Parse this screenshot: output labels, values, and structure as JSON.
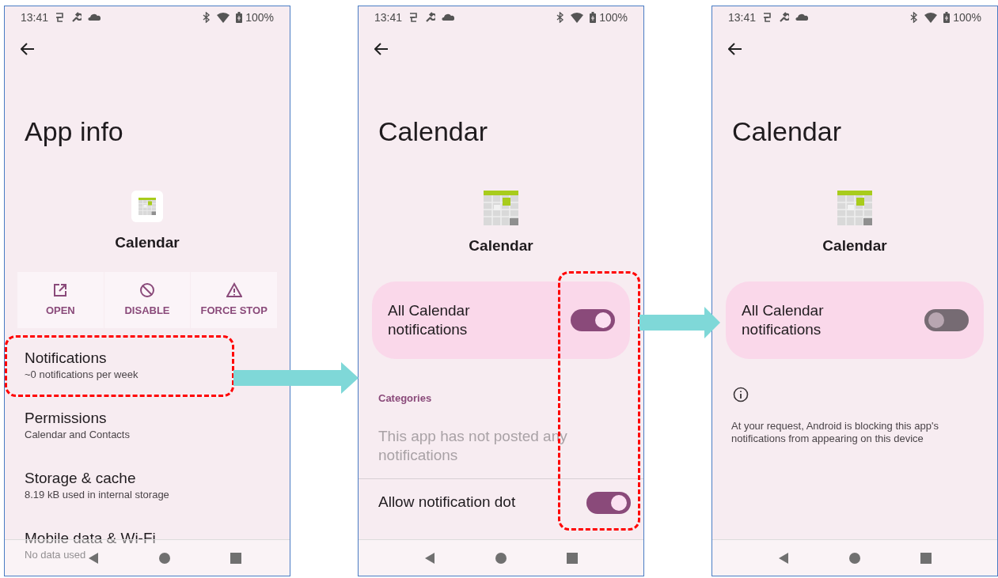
{
  "screens": [
    {
      "kind": "app_info",
      "status_bar": {
        "time": "13:41",
        "battery": "100%"
      },
      "title": "App info",
      "app_name": "Calendar",
      "actions": [
        {
          "kind": "open",
          "label": "OPEN"
        },
        {
          "kind": "disable",
          "label": "DISABLE"
        },
        {
          "kind": "stop",
          "label": "FORCE STOP"
        }
      ],
      "items": [
        {
          "title": "Notifications",
          "subtitle": "~0 notifications per week",
          "highlighted": true
        },
        {
          "title": "Permissions",
          "subtitle": "Calendar and Contacts",
          "highlighted": false
        },
        {
          "title": "Storage & cache",
          "subtitle": "8.19 kB used in internal storage",
          "highlighted": false
        },
        {
          "title": "Mobile data & Wi-Fi",
          "subtitle": "No data used",
          "highlighted": false
        }
      ]
    },
    {
      "kind": "notifications",
      "status_bar": {
        "time": "13:41",
        "battery": "100%"
      },
      "title": "Calendar",
      "app_name": "Calendar",
      "master": {
        "label": "All Calendar notifications",
        "on": true
      },
      "section": "Categories",
      "empty_text": "This app has not posted any notifications",
      "dot": {
        "label": "Allow notification dot",
        "on": true
      },
      "toggles_highlighted": true
    },
    {
      "kind": "blocked",
      "status_bar": {
        "time": "13:41",
        "battery": "100%"
      },
      "title": "Calendar",
      "app_name": "Calendar",
      "master": {
        "label": "All Calendar notifications",
        "on": false
      },
      "info": "At your request, Android is blocking this app's notifications from appearing on this device"
    }
  ]
}
